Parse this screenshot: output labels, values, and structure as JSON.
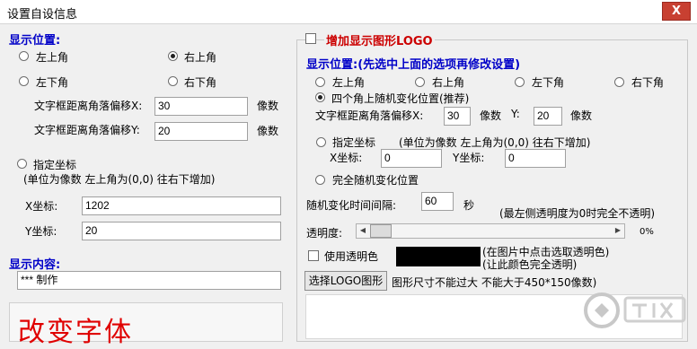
{
  "window": {
    "title": "设置自设信息",
    "close_label": "X"
  },
  "left": {
    "position_header": "显示位置:",
    "positions": [
      "左上角",
      "右上角",
      "左下角",
      "右下角"
    ],
    "selected_position": "右上角",
    "offset_x_label": "文字框距离角落偏移X:",
    "offset_x_value": "30",
    "offset_y_label": "文字框距离角落偏移Y:",
    "offset_y_value": "20",
    "unit_pixel": "像数",
    "custom_label": "指定坐标",
    "custom_hint": "(单位为像数  左上角为(0,0) 往右下增加)",
    "x_label": "X坐标:",
    "x_value": "1202",
    "y_label": "Y坐标:",
    "y_value": "20",
    "content_header": "显示内容:",
    "content_value": "*** 制作",
    "preview_text": "改变字体"
  },
  "right": {
    "logo_checkbox_label": "增加显示图形LOGO",
    "position_header": "显示位置:(先选中上面的选项再修改设置)",
    "positions": [
      "左上角",
      "右上角",
      "左下角",
      "右下角"
    ],
    "random_corner_label": "四个角上随机变化位置(推荐)",
    "offset_x_label": "文字框距离角落偏移X:",
    "offset_x_value": "30",
    "unit_pixel": "像数",
    "y_label": "Y:",
    "offset_y_value": "20",
    "custom_label": "指定坐标",
    "custom_hint": "(单位为像数  左上角为(0,0) 往右下增加)",
    "x_coord_label": "X坐标:",
    "x_coord_value": "0",
    "y_coord_label": "Y坐标:",
    "y_coord_value": "0",
    "full_random_label": "完全随机变化位置",
    "interval_label": "随机变化时间间隔:",
    "interval_value": "60",
    "interval_unit": "秒",
    "transparency_note": "(最左侧透明度为0时完全不透明)",
    "transparency_label": "透明度:",
    "transparency_value": "0%",
    "transparency_level": 0,
    "use_transparent_color_label": "使用透明色",
    "transparent_color": "#000000",
    "color_hint_1": "(在图片中点击选取透明色)",
    "color_hint_2": "(让此颜色完全透明)",
    "choose_logo_button": "选择LOGO图形",
    "logo_size_hint": "图形尺寸不能过大 不能大于450*150像数)"
  },
  "colors": {
    "blue_header": "#0000c8",
    "red_header": "#cc0000",
    "preview_text": "#e00000",
    "close_button": "#c84031"
  },
  "icons": {
    "close": "close-icon",
    "watermark": "site-watermark-logo"
  }
}
